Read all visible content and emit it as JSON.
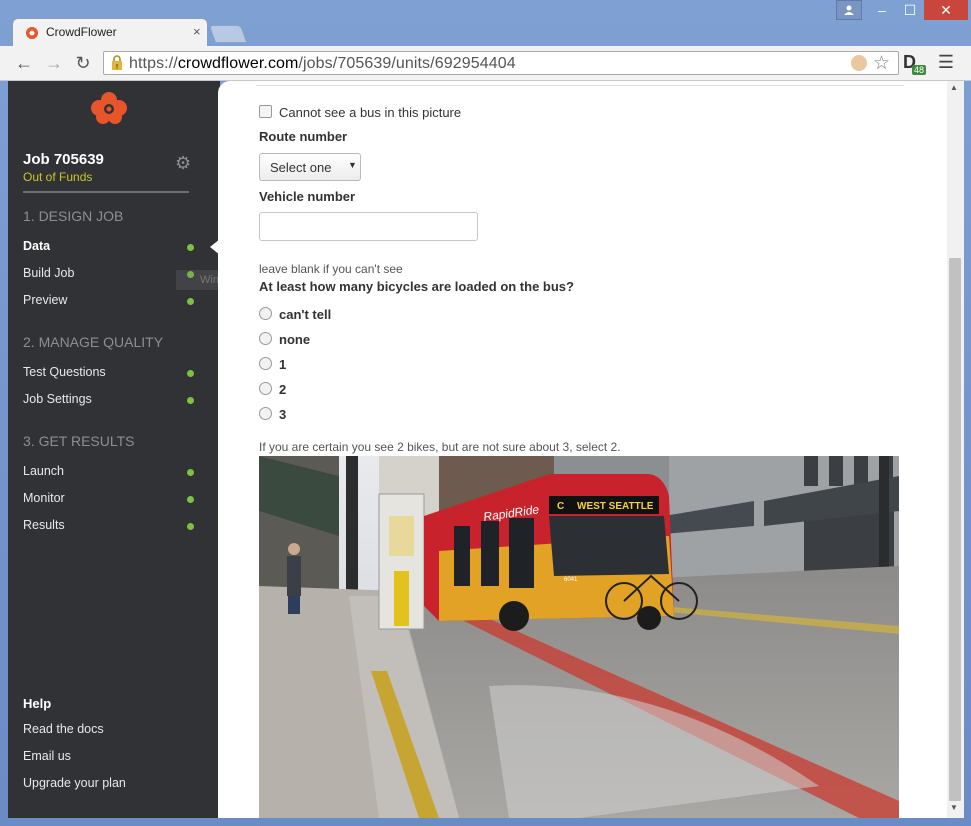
{
  "browser": {
    "tab_title": "CrowdFlower",
    "tab_close": "×",
    "url_scheme": "https://",
    "url_host": "crowdflower.com",
    "url_path": "/jobs/705639/units/692954404",
    "ext_badge": "48",
    "window_buttons": [
      "–",
      "☐",
      "✕"
    ]
  },
  "sidebar": {
    "job_title": "Job 705639",
    "job_status": "Out of Funds",
    "sections": [
      {
        "heading": "1. Design Job",
        "items": [
          {
            "label": "Data",
            "active": true
          },
          {
            "label": "Build Job"
          },
          {
            "label": "Preview"
          }
        ]
      },
      {
        "heading": "2. Manage Quality",
        "items": [
          {
            "label": "Test Questions"
          },
          {
            "label": "Job Settings"
          }
        ]
      },
      {
        "heading": "3. Get Results",
        "items": [
          {
            "label": "Launch"
          },
          {
            "label": "Monitor"
          },
          {
            "label": "Results"
          }
        ]
      }
    ],
    "tooltip": "Window",
    "help": {
      "heading": "Help",
      "links": [
        "Read the docs",
        "Email us",
        "Upgrade your plan"
      ]
    },
    "status_dot_color": "#7cc242",
    "status_text_color": "#c8c828"
  },
  "form": {
    "no_bus_checkbox": "Cannot see a bus in this picture",
    "route_label": "Route number",
    "route_select_value": "Select one",
    "vehicle_label": "Vehicle number",
    "vehicle_value": "",
    "vehicle_hint": "leave blank if you can't see",
    "bikes_question": "At least how many bicycles are loaded on the bus?",
    "bike_options": [
      "can't tell",
      "none",
      "1",
      "2",
      "3"
    ],
    "bikes_hint": "If you are certain you see 2 bikes, but are not sure about 3, select 2.",
    "bus_sign": "WEST SEATTLE",
    "bus_brand": "RapidRide",
    "bus_number": "6041",
    "bus_route": "C"
  }
}
